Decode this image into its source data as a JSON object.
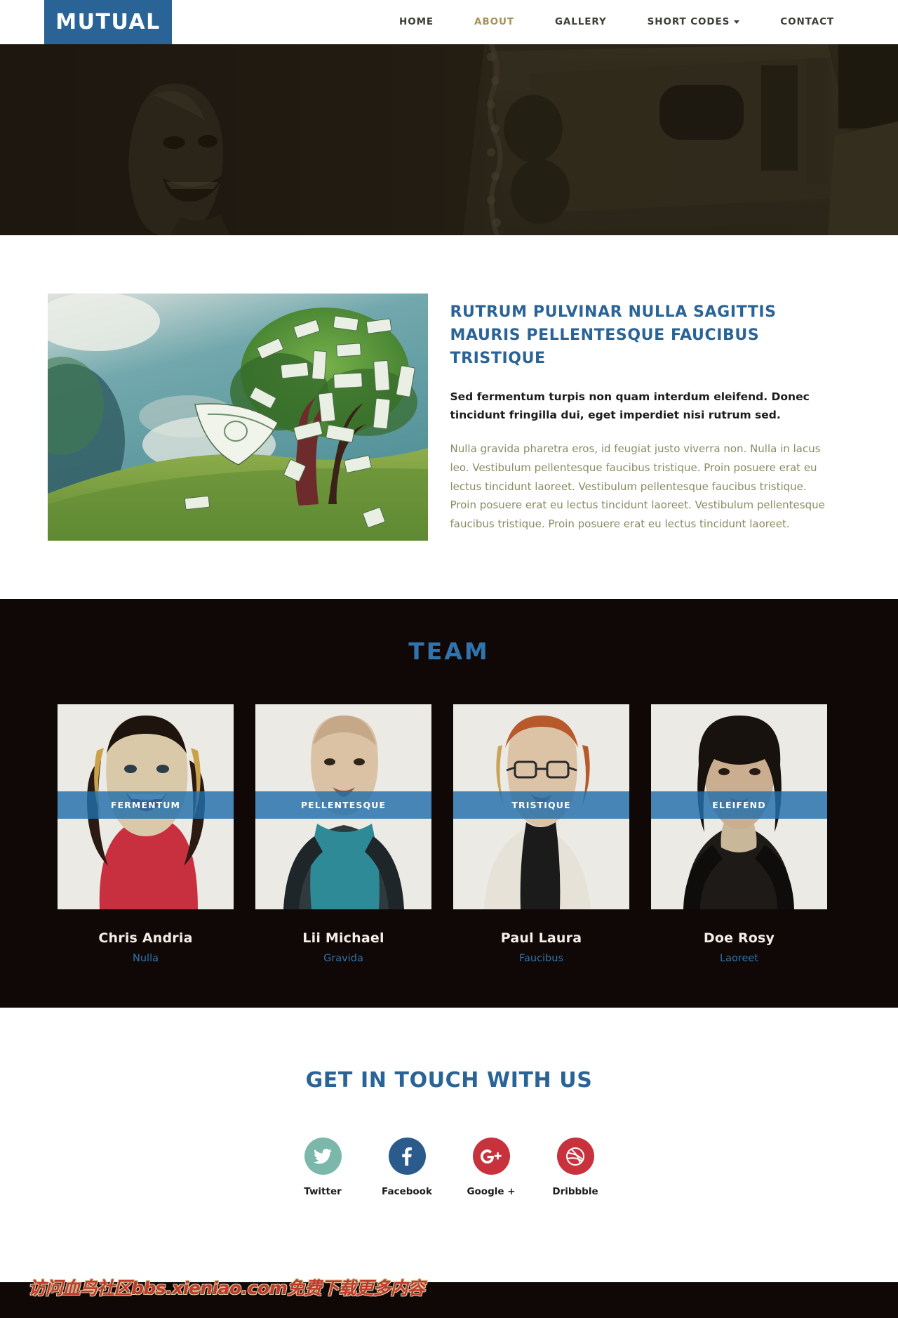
{
  "header": {
    "logo": "MUTUAL",
    "nav": [
      {
        "label": "HOME",
        "active": false,
        "caret": false
      },
      {
        "label": "ABOUT",
        "active": true,
        "caret": false
      },
      {
        "label": "GALLERY",
        "active": false,
        "caret": false
      },
      {
        "label": "SHORT CODES",
        "active": false,
        "caret": true
      },
      {
        "label": "CONTACT",
        "active": false,
        "caret": false
      }
    ]
  },
  "hero": {
    "alt": "dark banner with laughing face figure and euro banknotes"
  },
  "about": {
    "image_alt": "money tree illustration with dollar bills on a green hill",
    "title": "RUTRUM PULVINAR NULLA SAGITTIS MAURIS PELLENTESQUE FAUCIBUS TRISTIQUE",
    "lead": "Sed fermentum turpis non quam interdum eleifend. Donec tincidunt fringilla dui, eget imperdiet nisi rutrum sed.",
    "body": "Nulla gravida pharetra eros, id feugiat justo viverra non. Nulla in lacus leo. Vestibulum pellentesque faucibus tristique. Proin posuere erat eu lectus tincidunt laoreet. Vestibulum pellentesque faucibus tristique. Proin posuere erat eu lectus tincidunt laoreet. Vestibulum pellentesque faucibus tristique. Proin posuere erat eu lectus tincidunt laoreet."
  },
  "team": {
    "title": "TEAM",
    "members": [
      {
        "banner": "FERMENTUM",
        "name": "Chris Andria",
        "role": "Nulla",
        "photo": "woman-blonde-red-top"
      },
      {
        "banner": "PELLENTESQUE",
        "name": "Lii Michael",
        "role": "Gravida",
        "photo": "man-teal-shirt"
      },
      {
        "banner": "TRISTIQUE",
        "name": "Paul Laura",
        "role": "Faucibus",
        "photo": "woman-glasses-white-jacket"
      },
      {
        "banner": "ELEIFEND",
        "name": "Doe Rosy",
        "role": "Laoreet",
        "photo": "woman-dark-hair-jacket"
      }
    ]
  },
  "contact": {
    "title": "GET IN TOUCH WITH US",
    "socials": [
      {
        "label": "Twitter",
        "icon": "twitter-icon",
        "color": "#7bb7ab"
      },
      {
        "label": "Facebook",
        "icon": "facebook-icon",
        "color": "#2a5b8c"
      },
      {
        "label": "Google +",
        "icon": "google-plus-icon",
        "color": "#c8323c"
      },
      {
        "label": "Dribbble",
        "icon": "dribbble-icon",
        "color": "#c8323c"
      }
    ]
  },
  "footer": {
    "watermark": "访问血鸟社区bbs.xieniao.com免费下载更多内容"
  },
  "colors": {
    "brand_blue": "#2a6496",
    "accent_gold": "#a59255",
    "dark": "#100806",
    "body_olive": "#8a8a63"
  }
}
